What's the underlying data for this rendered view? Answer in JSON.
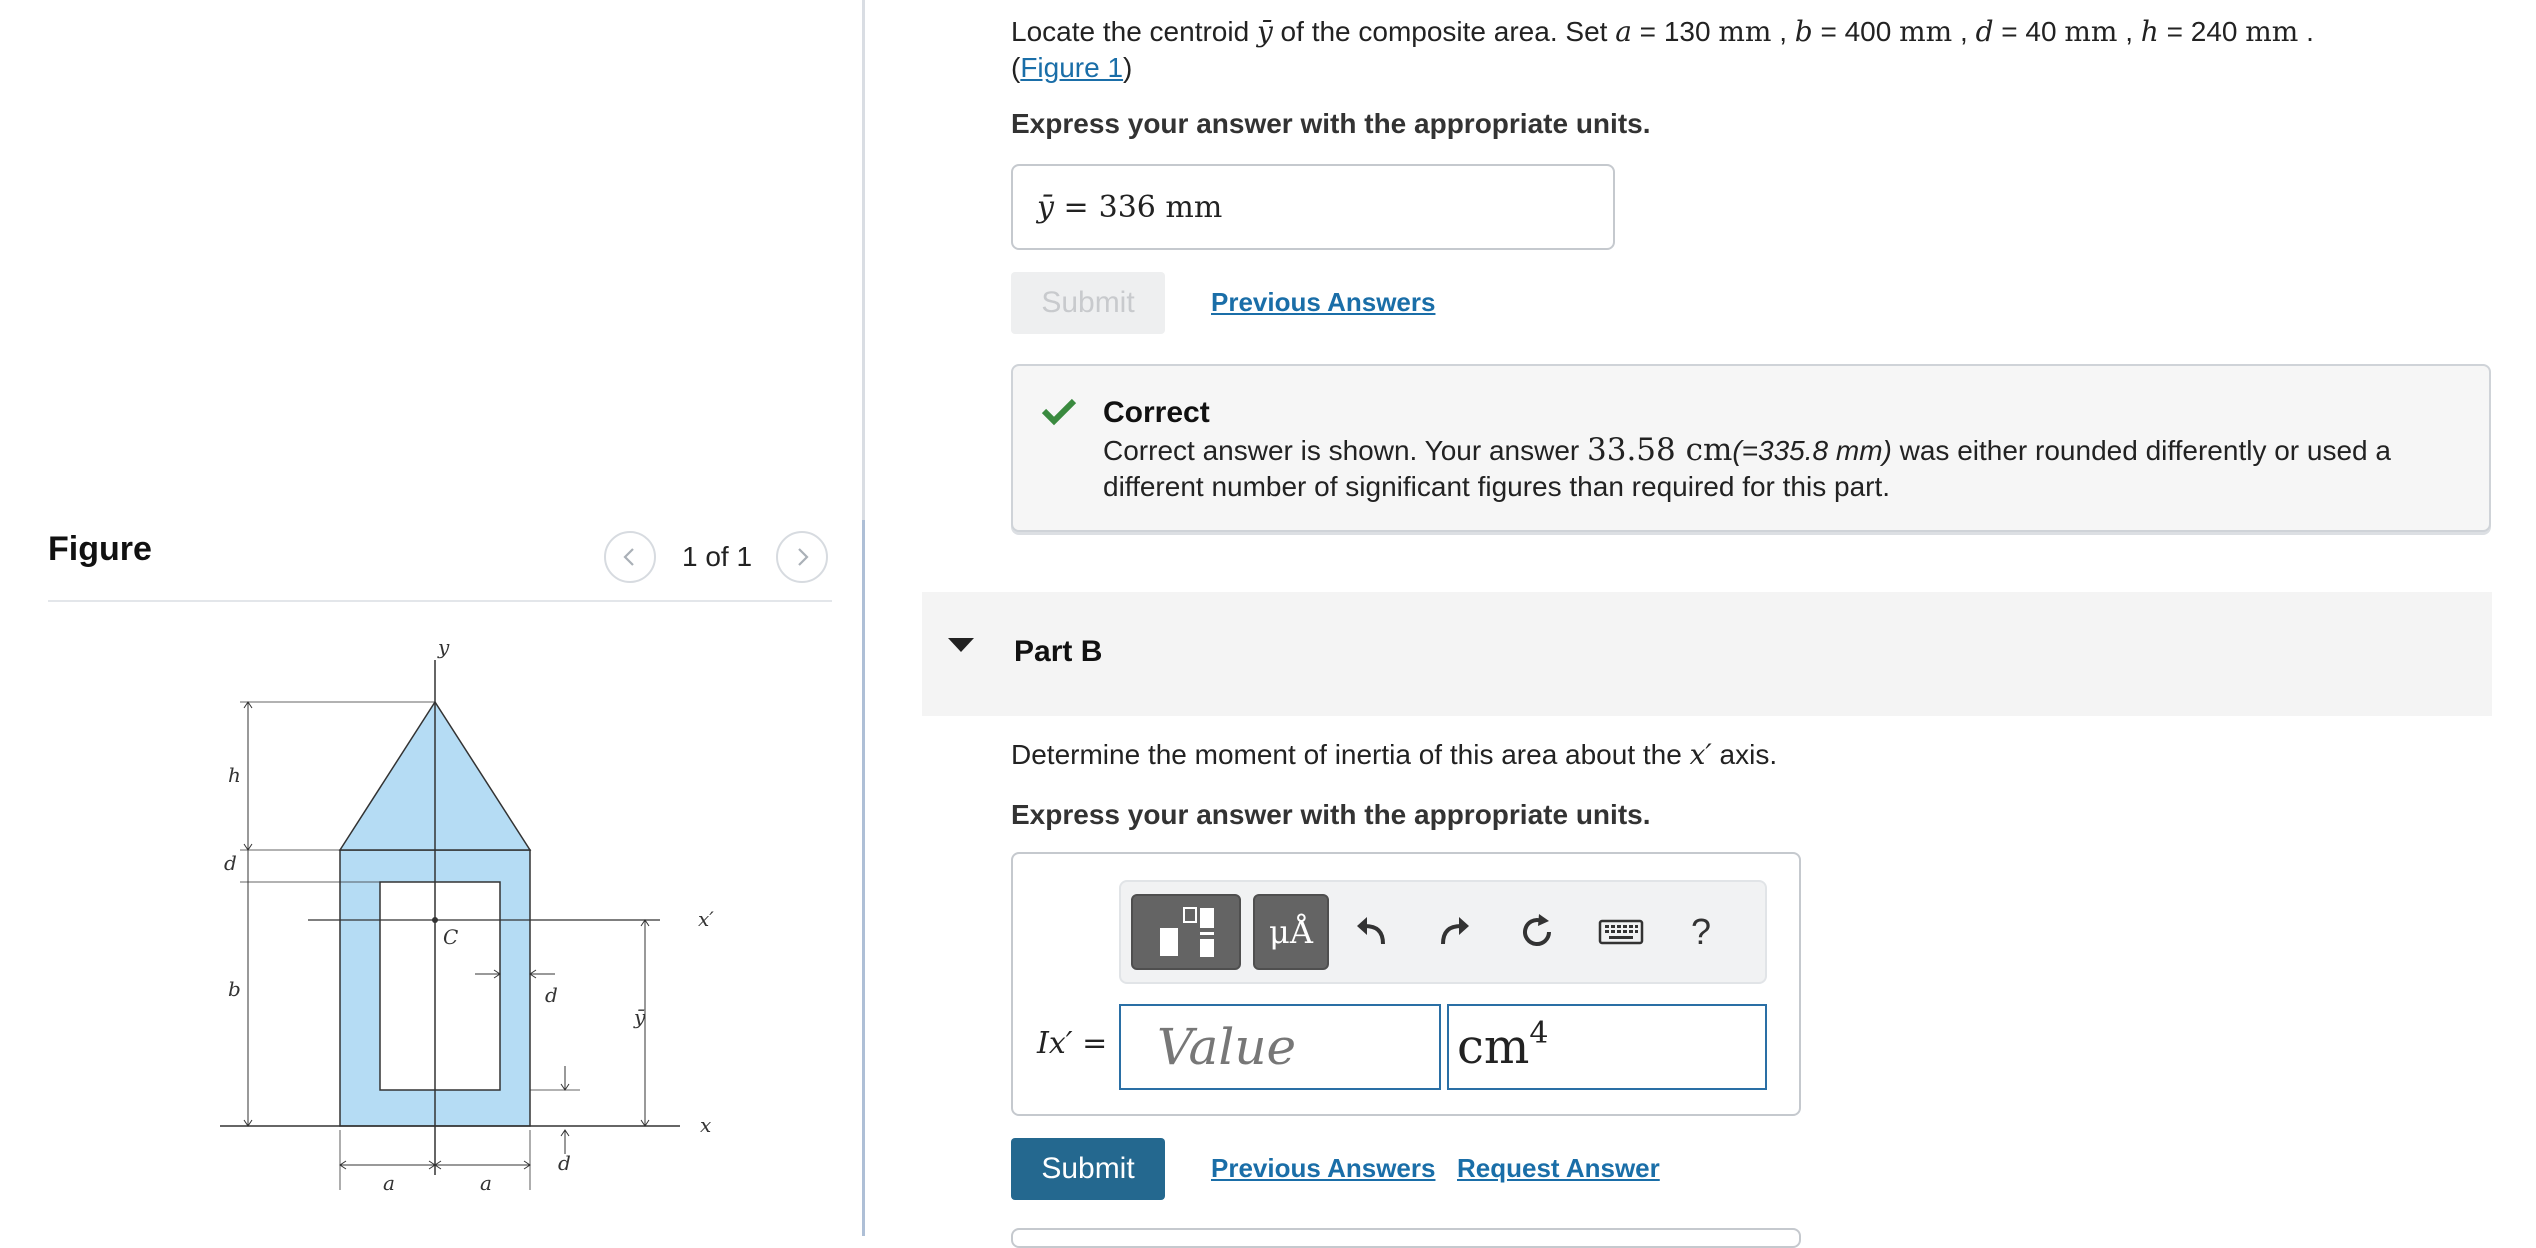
{
  "figure_panel": {
    "title": "Figure",
    "counter": "1 of 1",
    "labels": {
      "y_axis": "y",
      "x_axis": "x",
      "x_prime": "x′",
      "centroid": "C",
      "h": "h",
      "d_left": "d",
      "b": "b",
      "d_inner": "d",
      "y_bar": "ȳ",
      "a_left": "a",
      "a_right": "a",
      "d_bottom": "d"
    }
  },
  "part_a": {
    "q_prefix": "Locate the centroid ",
    "q_ybar": "ȳ",
    "q_mid": " of the composite area. Set ",
    "params": [
      {
        "sym": "a",
        "eq": " = 130 ",
        "unit": "mm",
        "sep": " , "
      },
      {
        "sym": "b",
        "eq": " = 400 ",
        "unit": "mm",
        "sep": " , "
      },
      {
        "sym": "d",
        "eq": " = 40 ",
        "unit": "mm",
        "sep": " , "
      },
      {
        "sym": "h",
        "eq": " = 240 ",
        "unit": "mm",
        "sep": " ."
      }
    ],
    "figure_link_open": "(",
    "figure_link": "Figure 1",
    "figure_link_close": ")",
    "instruction": "Express your answer with the appropriate units.",
    "answer_label": "ȳ = ",
    "answer_value": "336 mm",
    "submit_label": "Submit",
    "previous_answers": "Previous Answers",
    "feedback": {
      "title": "Correct",
      "body_1": "Correct answer is shown. Your answer ",
      "body_value": "33.58 cm",
      "body_paren": "(=335.8 mm)",
      "body_2": " was either rounded differently or used a different number of significant figures than required for this part."
    }
  },
  "part_b": {
    "title": "Part B",
    "question_1": "Determine the moment of inertia of this area about the ",
    "question_sym": "x′",
    "question_2": " axis.",
    "instruction": "Express your answer with the appropriate units.",
    "toolbar": {
      "units_label": "μÅ",
      "help_label": "?"
    },
    "input_label": "Ix′ = ",
    "value_placeholder": "Value",
    "unit_value": "cm",
    "unit_exponent": "4",
    "submit_label": "Submit",
    "previous_answers": "Previous Answers",
    "request_answer": "Request Answer"
  },
  "colors": {
    "link": "#1a6ea8",
    "submit_bg": "#24688f",
    "correct_green": "#3a8a3f",
    "shape_fill": "#b5dcf4"
  }
}
